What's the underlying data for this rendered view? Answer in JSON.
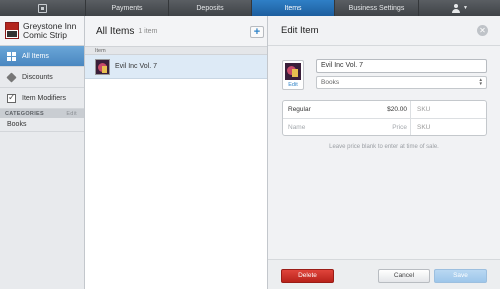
{
  "nav": {
    "tabs": [
      {
        "label": "Payments"
      },
      {
        "label": "Deposits"
      },
      {
        "label": "Items",
        "active": true
      },
      {
        "label": "Business Settings"
      }
    ]
  },
  "sidebar": {
    "store_line1": "Greystone Inn",
    "store_line2": "Comic Strip",
    "items": [
      {
        "label": "All Items",
        "icon": "grid-icon",
        "active": true
      },
      {
        "label": "Discounts",
        "icon": "tag-icon"
      },
      {
        "label": "Item Modifiers",
        "icon": "checkbox-icon"
      }
    ],
    "categories_header": "CATEGORIES",
    "categories_edit": "Edit",
    "categories": [
      "Books"
    ]
  },
  "list": {
    "title": "All Items",
    "count": "1 item",
    "column_header": "Item",
    "rows": [
      {
        "label": "Evil Inc Vol. 7"
      }
    ]
  },
  "panel": {
    "title": "Edit Item",
    "image_edit_label": "Edit",
    "name_value": "Evil Inc Vol. 7",
    "category_value": "Books",
    "prices": [
      {
        "name": "Regular",
        "price": "$20.00",
        "sku": "SKU"
      },
      {
        "name": "Name",
        "price": "Price",
        "sku": "SKU"
      }
    ],
    "hint": "Leave price blank to enter at time of sale.",
    "delete_label": "Delete",
    "cancel_label": "Cancel",
    "save_label": "Save"
  },
  "colors": {
    "accent": "#2e82c7",
    "nav_active": "#1d5e9e",
    "delete": "#c7302a",
    "save_disabled": "#a9cdee"
  }
}
